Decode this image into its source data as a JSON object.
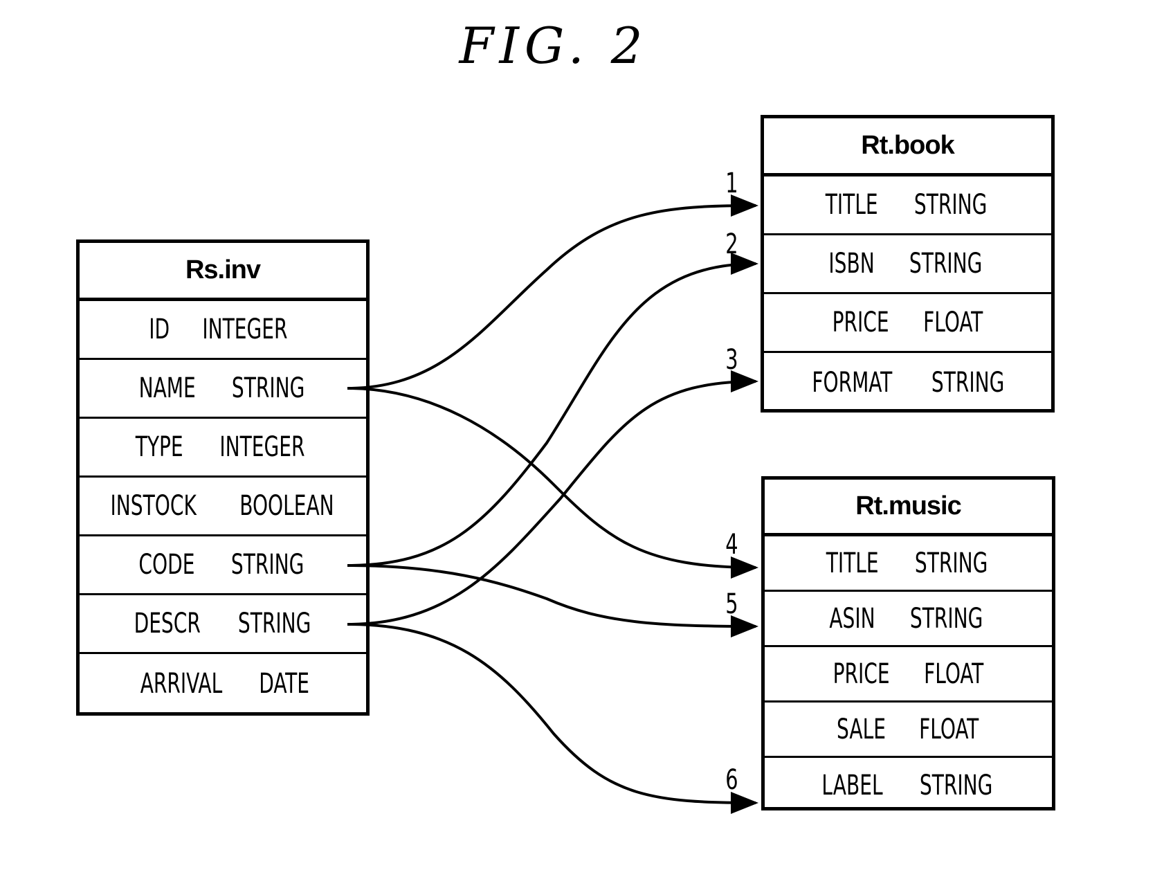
{
  "figure": {
    "title": "FIG. 2"
  },
  "source_table": {
    "name": "Rs.inv",
    "fields": [
      {
        "name": "ID",
        "type": "INTEGER"
      },
      {
        "name": "NAME",
        "type": "STRING"
      },
      {
        "name": "TYPE",
        "type": "INTEGER"
      },
      {
        "name": "INSTOCK",
        "type": "BOOLEAN"
      },
      {
        "name": "CODE",
        "type": "STRING"
      },
      {
        "name": "DESCR",
        "type": "STRING"
      },
      {
        "name": "ARRIVAL",
        "type": "DATE"
      }
    ]
  },
  "target_tables": [
    {
      "name": "Rt.book",
      "fields": [
        {
          "name": "TITLE",
          "type": "STRING"
        },
        {
          "name": "ISBN",
          "type": "STRING"
        },
        {
          "name": "PRICE",
          "type": "FLOAT"
        },
        {
          "name": "FORMAT",
          "type": "STRING"
        }
      ]
    },
    {
      "name": "Rt.music",
      "fields": [
        {
          "name": "TITLE",
          "type": "STRING"
        },
        {
          "name": "ASIN",
          "type": "STRING"
        },
        {
          "name": "PRICE",
          "type": "FLOAT"
        },
        {
          "name": "SALE",
          "type": "FLOAT"
        },
        {
          "name": "LABEL",
          "type": "STRING"
        }
      ]
    }
  ],
  "mappings": [
    {
      "label": "1",
      "from": "Rs.inv.NAME",
      "to": "Rt.book.TITLE"
    },
    {
      "label": "2",
      "from": "Rs.inv.CODE",
      "to": "Rt.book.ISBN"
    },
    {
      "label": "3",
      "from": "Rs.inv.DESCR",
      "to": "Rt.book.FORMAT"
    },
    {
      "label": "4",
      "from": "Rs.inv.NAME",
      "to": "Rt.music.TITLE"
    },
    {
      "label": "5",
      "from": "Rs.inv.CODE",
      "to": "Rt.music.ASIN"
    },
    {
      "label": "6",
      "from": "Rs.inv.DESCR",
      "to": "Rt.music.LABEL"
    }
  ]
}
